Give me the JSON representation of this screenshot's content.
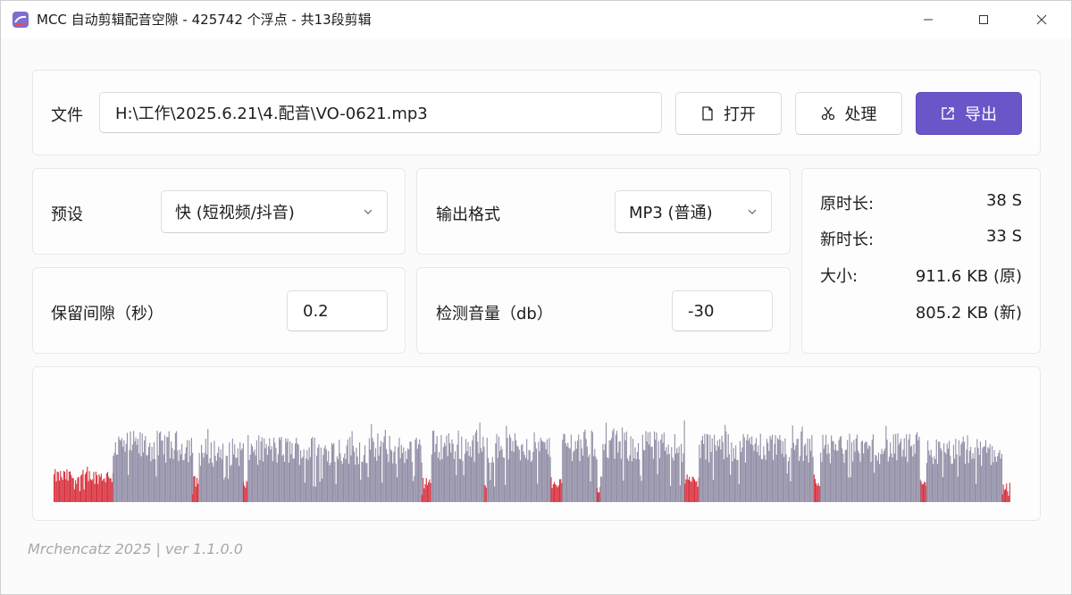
{
  "window": {
    "title": "MCC 自动剪辑配音空隙 - 425742 个浮点 - 共13段剪辑",
    "min_icon": "minimize-icon",
    "max_icon": "maximize-icon",
    "close_icon": "close-icon"
  },
  "file": {
    "label": "文件",
    "path": "H:\\工作\\2025.6.21\\4.配音\\VO-0621.mp3",
    "open_label": "打开",
    "process_label": "处理",
    "export_label": "导出"
  },
  "settings": {
    "preset_label": "预设",
    "preset_value": "快 (短视频/抖音)",
    "format_label": "输出格式",
    "format_value": "MP3 (普通)",
    "gap_label": "保留间隙（秒）",
    "gap_value": "0.2",
    "threshold_label": "检测音量（db）",
    "threshold_value": "-30"
  },
  "stats": {
    "orig_label": "原时长:",
    "orig_value": "38 S",
    "new_label": "新时长:",
    "new_value": "33 S",
    "size_label": "大小:",
    "size_orig": "911.6 KB (原)",
    "size_new": "805.2 KB (新)"
  },
  "colors": {
    "accent": "#6a56c8",
    "kept_wave": "#918ea6",
    "cut_wave": "#d8303d"
  },
  "waveform_segments": [
    {
      "kind": "cut",
      "from": 0.0,
      "to": 0.062,
      "level": 0.37
    },
    {
      "kind": "keep",
      "from": 0.062,
      "to": 0.145,
      "level": 0.8
    },
    {
      "kind": "cut",
      "from": 0.145,
      "to": 0.152,
      "level": 0.3
    },
    {
      "kind": "keep",
      "from": 0.152,
      "to": 0.198,
      "level": 0.72
    },
    {
      "kind": "cut",
      "from": 0.198,
      "to": 0.203,
      "level": 0.25
    },
    {
      "kind": "keep",
      "from": 0.203,
      "to": 0.385,
      "level": 0.75
    },
    {
      "kind": "cut",
      "from": 0.385,
      "to": 0.395,
      "level": 0.28
    },
    {
      "kind": "keep",
      "from": 0.395,
      "to": 0.45,
      "level": 0.82
    },
    {
      "kind": "cut",
      "from": 0.45,
      "to": 0.453,
      "level": 0.2
    },
    {
      "kind": "keep",
      "from": 0.453,
      "to": 0.52,
      "level": 0.78
    },
    {
      "kind": "cut",
      "from": 0.52,
      "to": 0.532,
      "level": 0.28
    },
    {
      "kind": "keep",
      "from": 0.532,
      "to": 0.568,
      "level": 0.83
    },
    {
      "kind": "cut",
      "from": 0.568,
      "to": 0.572,
      "level": 0.18
    },
    {
      "kind": "keep",
      "from": 0.572,
      "to": 0.66,
      "level": 0.8
    },
    {
      "kind": "cut",
      "from": 0.66,
      "to": 0.675,
      "level": 0.3
    },
    {
      "kind": "keep",
      "from": 0.675,
      "to": 0.795,
      "level": 0.8
    },
    {
      "kind": "cut",
      "from": 0.795,
      "to": 0.802,
      "level": 0.3
    },
    {
      "kind": "keep",
      "from": 0.802,
      "to": 0.907,
      "level": 0.77
    },
    {
      "kind": "cut",
      "from": 0.907,
      "to": 0.913,
      "level": 0.25
    },
    {
      "kind": "keep",
      "from": 0.913,
      "to": 0.992,
      "level": 0.72
    },
    {
      "kind": "cut",
      "from": 0.992,
      "to": 1.0,
      "level": 0.22
    }
  ]
}
